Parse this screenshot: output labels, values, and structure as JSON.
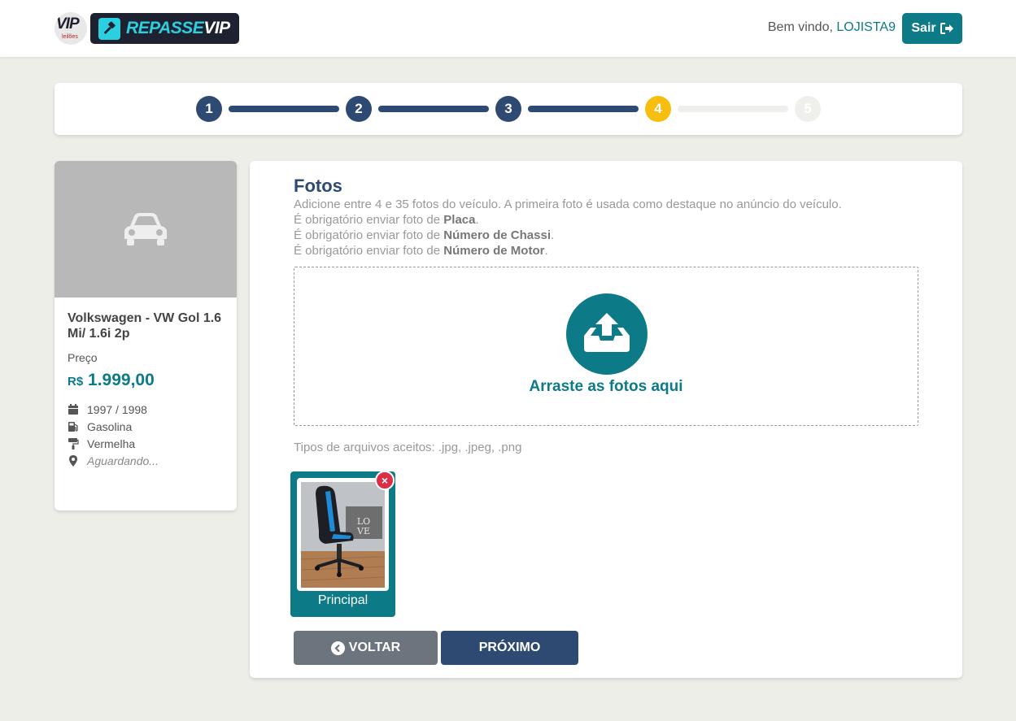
{
  "header": {
    "logo_vip_text": "VIP",
    "logo_vip_sub": "leilões",
    "logo_brand_a": "REPASSE",
    "logo_brand_b": "VIP",
    "welcome_prefix": "Bem vindo,",
    "username": "LOJISTA9",
    "logout_label": "Sair"
  },
  "stepper": {
    "steps": [
      "1",
      "2",
      "3",
      "4",
      "5"
    ],
    "current": 4,
    "colors": {
      "done": "#2e4a72",
      "active": "#f7bd0f",
      "todo": "#efefeb"
    }
  },
  "vehicle": {
    "image_placeholder_icon": "car-icon",
    "title": "Volkswagen - VW Gol 1.6 Mi/ 1.6i 2p",
    "price_label": "Preço",
    "currency": "R$",
    "price": "1.999,00",
    "year": "1997 / 1998",
    "fuel": "Gasolina",
    "color": "Vermelha",
    "location": "Aguardando..."
  },
  "photos": {
    "title": "Fotos",
    "desc_line1": "Adicione entre 4 e 35 fotos do veículo. A primeira foto é usada como destaque no anúncio do veículo.",
    "required_prefix": "É obrigatório enviar foto de",
    "required_items": [
      "Placa",
      "Número de Chassi",
      "Número de Motor"
    ],
    "drop_text": "Arraste as fotos aqui",
    "accepted_types": "Tipos de arquivos aceitos: .jpg, .jpeg, .png",
    "thumbnail_caption": "Principal",
    "remove_symbol": "×"
  },
  "buttons": {
    "back": "VOLTAR",
    "next": "PRÓXIMO"
  },
  "colors": {
    "accent": "#0d7a87",
    "primary": "#2e4a72",
    "danger": "#dc2f45",
    "secondary": "#6c757d"
  }
}
